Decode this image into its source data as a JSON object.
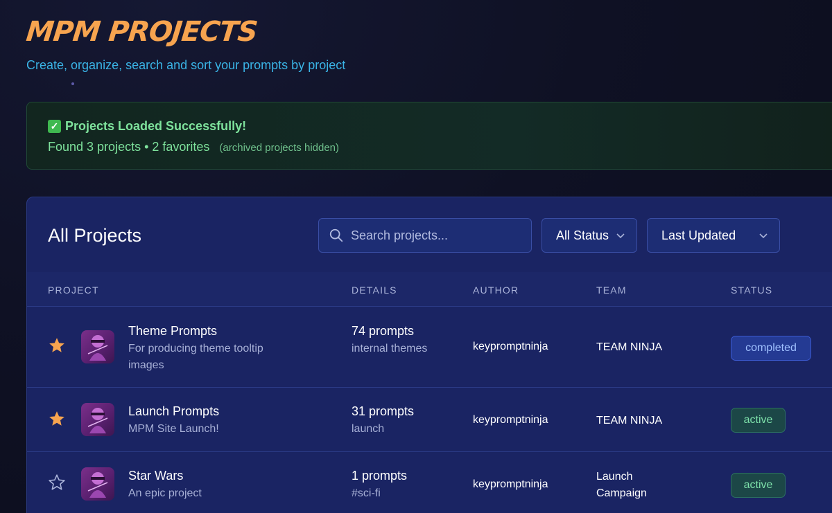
{
  "header": {
    "title": "MPM PROJECTS",
    "subtitle": "Create, organize, search and sort your prompts by project"
  },
  "status_banner": {
    "title": "Projects Loaded Successfully!",
    "detail": "Found 3 projects • 2 favorites",
    "note": "(archived projects hidden)"
  },
  "panel": {
    "title": "All Projects",
    "search_placeholder": "Search projects...",
    "status_filter": "All Status",
    "sort": "Last Updated"
  },
  "table": {
    "columns": [
      "PROJECT",
      "DETAILS",
      "AUTHOR",
      "TEAM",
      "STATUS"
    ],
    "rows": [
      {
        "favorite": true,
        "name": "Theme Prompts",
        "description": "For producing theme tooltip images",
        "prompt_count": "74 prompts",
        "tags": "internal themes",
        "author": "keypromptninja",
        "team": "TEAM NINJA",
        "status": "completed"
      },
      {
        "favorite": true,
        "name": "Launch Prompts",
        "description": "MPM Site Launch!",
        "prompt_count": "31 prompts",
        "tags": "launch",
        "author": "keypromptninja",
        "team": "TEAM NINJA",
        "status": "active"
      },
      {
        "favorite": false,
        "name": "Star Wars",
        "description": "An epic project",
        "prompt_count": "1 prompts",
        "tags": "#sci-fi",
        "author": "keypromptninja",
        "team": "Launch Campaign",
        "status": "active"
      }
    ]
  },
  "colors": {
    "accent_orange": "#f7a44f",
    "subtitle_blue": "#3ab4e6",
    "success_green": "#7ee29c",
    "panel_bg": "#1a2463",
    "favorite_star": "#f7a44f"
  },
  "icons": {
    "check": "check-box-icon",
    "search": "search-icon",
    "chevron": "chevron-down-icon",
    "star_filled": "star-filled-icon",
    "star_outline": "star-outline-icon",
    "avatar": "ninja-avatar-icon"
  }
}
